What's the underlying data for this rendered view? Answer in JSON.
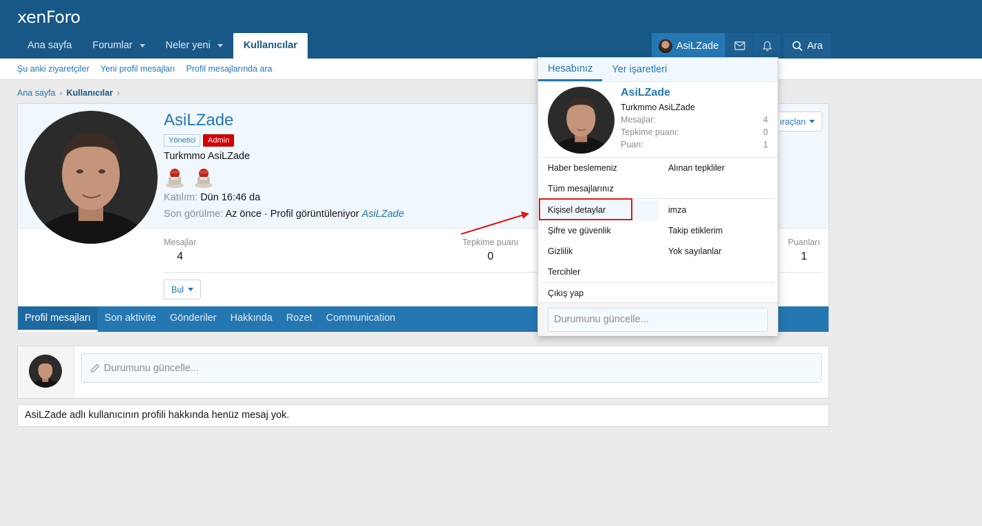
{
  "header": {
    "logo": "xenForo",
    "nav": [
      {
        "label": "Ana sayfa",
        "dropdown": false
      },
      {
        "label": "Forumlar",
        "dropdown": true
      },
      {
        "label": "Neler yeni",
        "dropdown": true
      },
      {
        "label": "Kullanıcılar",
        "dropdown": false,
        "active": true
      }
    ],
    "user_label": "AsiLZade",
    "search_label": "Ara",
    "colors": {
      "bar": "#185886",
      "accent": "#2577b1"
    }
  },
  "subnav": [
    "Şu anki ziyaretçiler",
    "Yeni profil mesajları",
    "Profil mesajlarında ara"
  ],
  "breadcrumb": {
    "home": "Ana sayfa",
    "current": "Kullanıcılar"
  },
  "profile": {
    "username": "AsiLZade",
    "badges": [
      "Yönetici",
      "Admin"
    ],
    "title": "Turkmmo AsiLZade",
    "joined_label": "Katılım:",
    "joined_value": "Dün 16:46 da",
    "seen_label": "Son görülme:",
    "seen_value": "Az önce · Profil görüntüleniyor",
    "seen_link": "AsiLZade",
    "stats": [
      {
        "label": "Mesajlar",
        "value": "4"
      },
      {
        "label": "Tepkime puanı",
        "value": "0"
      },
      {
        "label": "Puanları",
        "value": "1"
      }
    ],
    "find_button": "Bul",
    "tools_button": "ıraçları",
    "tabs": [
      "Profil mesajları",
      "Son aktivite",
      "Gönderiler",
      "Hakkında",
      "Rozet",
      "Communication"
    ]
  },
  "status": {
    "placeholder": "Durumunu güncelle..."
  },
  "empty_message": "AsiLZade adlı kullanıcının profili hakkında henüz mesaj yok.",
  "menu": {
    "tabs": [
      "Hesabınız",
      "Yer işaretleri"
    ],
    "name": "AsiLZade",
    "title": "Turkmmo AsiLZade",
    "stats": [
      {
        "label": "Mesajlar:",
        "value": "4"
      },
      {
        "label": "Tepkime puanı:",
        "value": "0"
      },
      {
        "label": "Puan:",
        "value": "1"
      }
    ],
    "items_left": [
      "Haber beslemeniz",
      "Tüm mesajlarınız"
    ],
    "items_right": [
      "Alınan tepkliler"
    ],
    "items2_left": [
      "Kişisel detaylar",
      "Şifre ve güvenlik",
      "Gizlilik",
      "Tercihler"
    ],
    "items2_right": [
      "imza",
      "Takip etiklerim",
      "Yok sayılanlar"
    ],
    "logout": "Çıkış yap",
    "status_placeholder": "Durumunu güncelle..."
  }
}
